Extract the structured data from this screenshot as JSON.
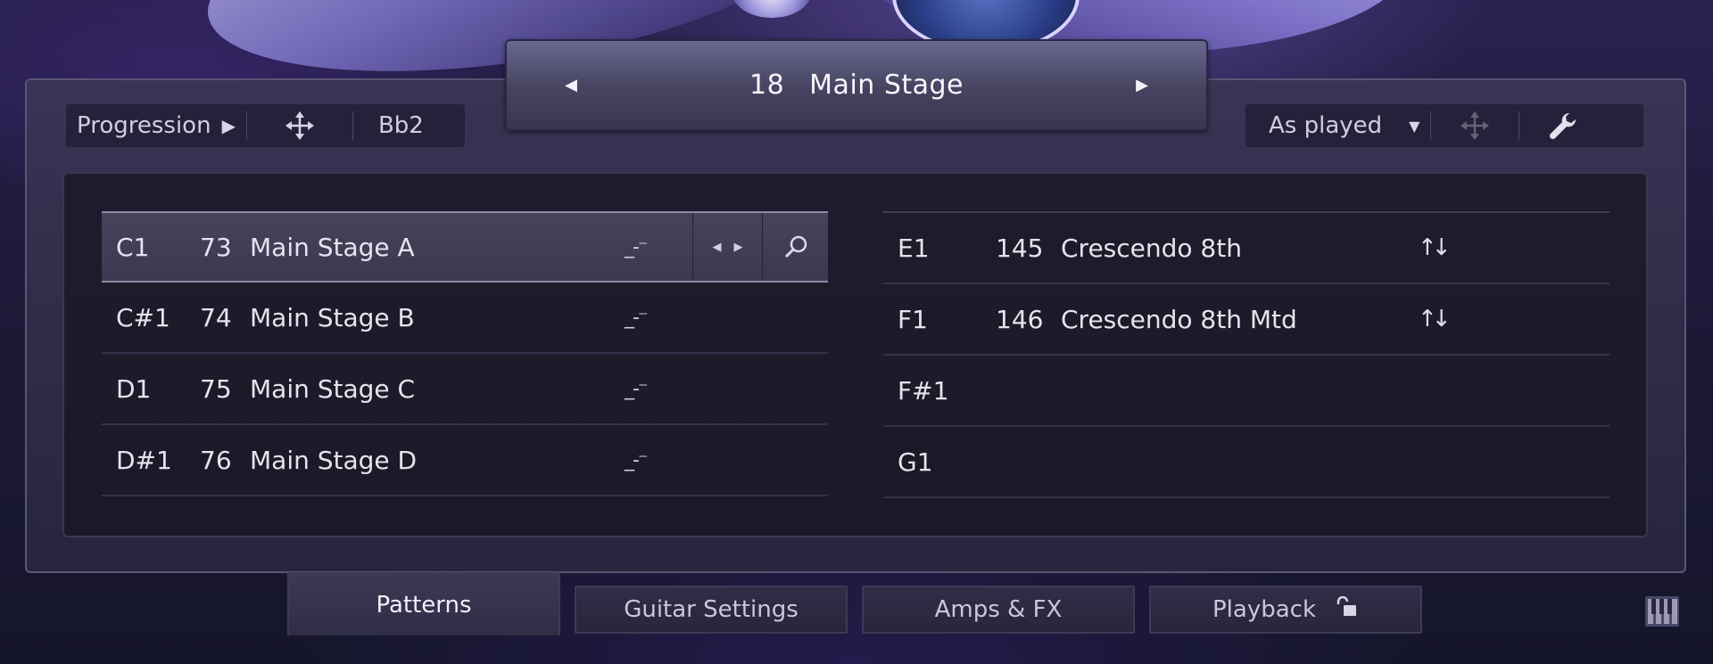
{
  "preset": {
    "number": "18",
    "name": "Main Stage"
  },
  "toolbar_left": {
    "progression_label": "Progression",
    "key_label": "Bb2"
  },
  "toolbar_right": {
    "mode_label": "As played"
  },
  "patterns_left": [
    {
      "note": "C1",
      "num": "73",
      "name": "Main Stage A",
      "selected": true
    },
    {
      "note": "C#1",
      "num": "74",
      "name": "Main Stage B"
    },
    {
      "note": "D1",
      "num": "75",
      "name": "Main Stage C"
    },
    {
      "note": "D#1",
      "num": "76",
      "name": "Main Stage D"
    }
  ],
  "patterns_right": [
    {
      "note": "E1",
      "num": "145",
      "name": "Crescendo 8th"
    },
    {
      "note": "F1",
      "num": "146",
      "name": "Crescendo 8th Mtd"
    },
    {
      "note": "F#1",
      "num": "",
      "name": ""
    },
    {
      "note": "G1",
      "num": "",
      "name": ""
    }
  ],
  "tabs": [
    {
      "label": "Patterns"
    },
    {
      "label": "Guitar Settings"
    },
    {
      "label": "Amps & FX"
    },
    {
      "label": "Playback"
    }
  ],
  "icons": {
    "prev": "arrow-left-icon",
    "next": "arrow-right-icon",
    "move": "move-icon",
    "wrench": "wrench-icon",
    "search": "search-icon",
    "lock": "lock-icon",
    "keyboard": "keyboard-icon",
    "dash": "dash-icon",
    "updown": "up-down-arrows-icon"
  },
  "colors": {
    "accent": "#6a6790",
    "panel": "#1d1c2c",
    "text": "#e4e4ee"
  }
}
